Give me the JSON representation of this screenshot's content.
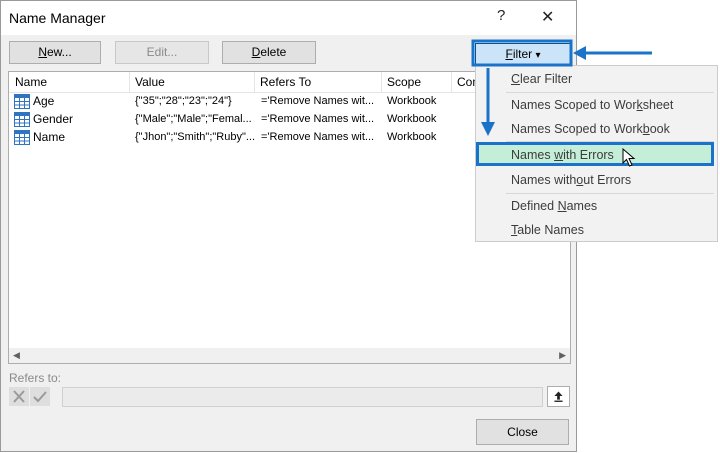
{
  "dialog": {
    "title": "Name Manager",
    "help_glyph": "?",
    "close_glyph": "✕"
  },
  "toolbar": {
    "new_label_u": "N",
    "new_label_rest": "ew...",
    "edit_label": "Edit...",
    "delete_label_u": "D",
    "delete_label_rest": "elete",
    "filter_label_u": "F",
    "filter_label_rest": "ilter",
    "filter_caret": "▾"
  },
  "table": {
    "columns": [
      "Name",
      "Value",
      "Refers To",
      "Scope",
      "Com"
    ],
    "rows": [
      {
        "name": "Age",
        "value": "{\"35\";\"28\";\"23\";\"24\"}",
        "refers_to": "='Remove Names wit...",
        "scope": "Workbook",
        "icon": "named-range-icon"
      },
      {
        "name": "Gender",
        "value": "{\"Male\";\"Male\";\"Femal...",
        "refers_to": "='Remove Names wit...",
        "scope": "Workbook",
        "icon": "named-range-icon"
      },
      {
        "name": "Name",
        "value": "{\"Jhon\";\"Smith\";\"Ruby\"...",
        "refers_to": "='Remove Names wit...",
        "scope": "Workbook",
        "icon": "named-range-icon"
      }
    ]
  },
  "refers_to": {
    "label": "Refers to:",
    "value": ""
  },
  "close_button": "Close",
  "filter_menu": {
    "items": [
      {
        "pre": "",
        "u": "C",
        "post": "lear Filter"
      },
      {
        "pre": "Names Scoped to Wor",
        "u": "k",
        "post": "sheet"
      },
      {
        "pre": "Names Scoped to Work",
        "u": "b",
        "post": "ook"
      },
      {
        "pre": "Names ",
        "u": "w",
        "post": "ith Errors"
      },
      {
        "pre": "Names with",
        "u": "o",
        "post": "ut Errors"
      },
      {
        "pre": "Defined ",
        "u": "N",
        "post": "ames"
      },
      {
        "pre": "",
        "u": "T",
        "post": "able Names"
      }
    ],
    "highlighted_index": 3
  },
  "colors": {
    "annotation": "#1a73c8",
    "highlight_fill": "#c5eed8",
    "filter_button": "#cce4f7",
    "icon_blue": "#2f74c0"
  }
}
